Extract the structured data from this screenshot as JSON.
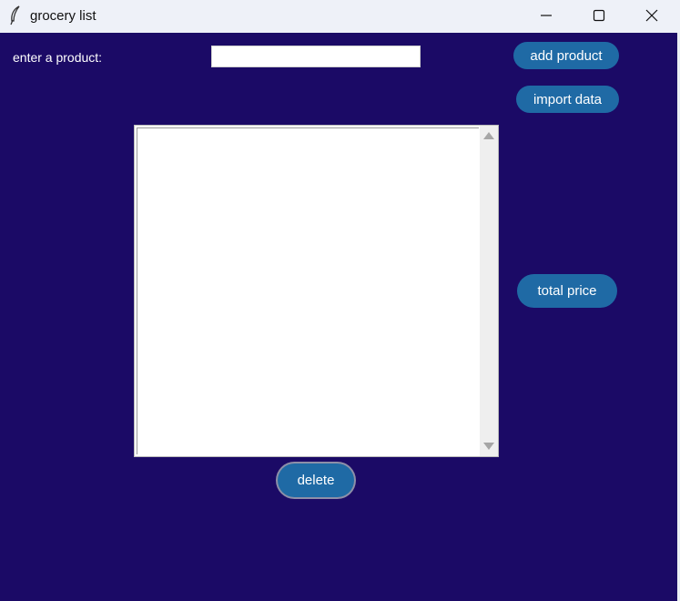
{
  "window": {
    "title": "grocery list",
    "app_icon": "feather-icon",
    "controls": [
      "minimize-icon",
      "maximize-icon",
      "close-icon"
    ]
  },
  "form": {
    "label": "enter a product:",
    "input_value": "",
    "add_button": "add product",
    "import_button": "import data"
  },
  "list": {
    "items": []
  },
  "actions": {
    "total_button": "total price",
    "delete_button": "delete"
  },
  "colors": {
    "background": "#1b0a66",
    "button": "#1f6aa5",
    "button_text": "#ffffff",
    "titlebar": "#eef1f8"
  }
}
